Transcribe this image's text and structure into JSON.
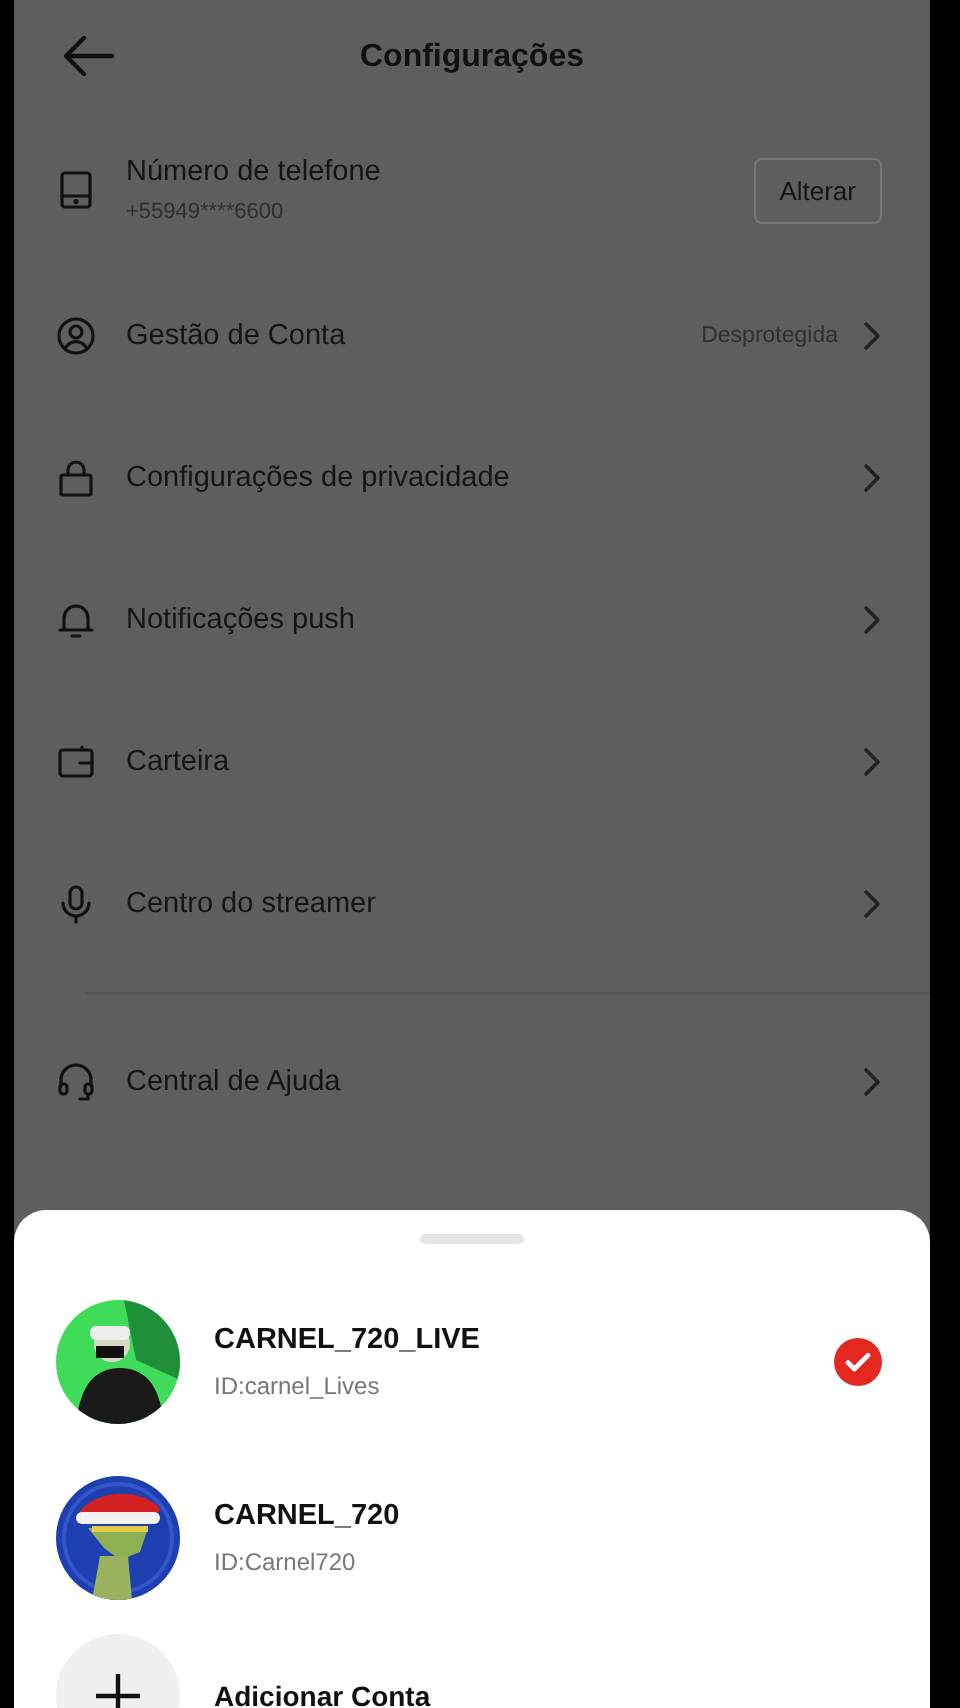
{
  "header": {
    "title": "Configurações"
  },
  "setting_groups": [
    [
      {
        "kind": "phone",
        "label": "Número de telefone",
        "sublabel": "+55949****6600",
        "button": "Alterar"
      },
      {
        "kind": "link",
        "label": "Gestão de Conta",
        "value": "Desprotegida"
      },
      {
        "kind": "link",
        "label": "Configurações de privacidade"
      },
      {
        "kind": "link",
        "label": "Notificações push"
      },
      {
        "kind": "link",
        "label": "Carteira"
      },
      {
        "kind": "link",
        "label": "Centro do streamer"
      }
    ],
    [
      {
        "kind": "link",
        "label": "Central de Ajuda"
      }
    ]
  ],
  "accounts": [
    {
      "name": "CARNEL_720_LIVE",
      "id": "ID:carnel_Lives",
      "selected": true
    },
    {
      "name": "CARNEL_720",
      "id": "ID:Carnel720",
      "selected": false
    }
  ],
  "add_account": {
    "label": "Adicionar Conta"
  }
}
